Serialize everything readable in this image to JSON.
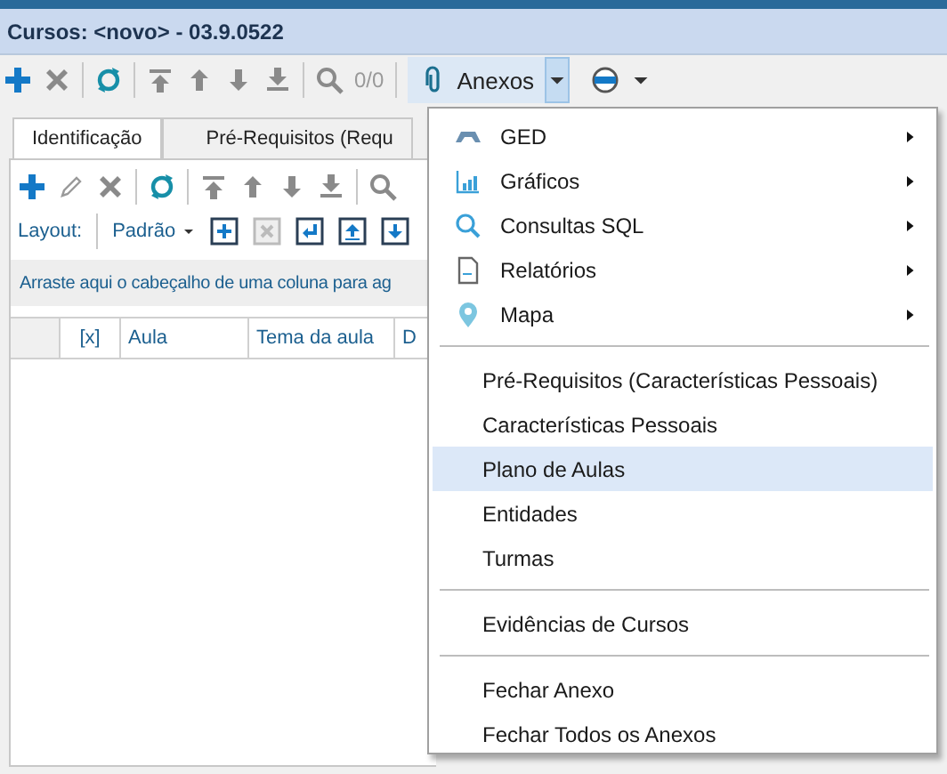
{
  "window": {
    "title": "Cursos: <novo> - 03.9.0522"
  },
  "toolbar": {
    "counter": "0/0",
    "attachments_button": {
      "label": "Anexos",
      "expanded": true
    }
  },
  "tabs": [
    {
      "label": "Identificação",
      "selected": true
    },
    {
      "label": "Pré-Requisitos (Requ",
      "selected": false
    }
  ],
  "layout": {
    "label": "Layout:",
    "value": "Padrão"
  },
  "group_panel": {
    "hint": "Arraste aqui o cabeçalho de uma coluna para ag"
  },
  "table": {
    "columns": [
      "[x]",
      "Aula",
      "Tema da aula",
      "D"
    ]
  },
  "menu": {
    "items": [
      {
        "kind": "submenu",
        "label": "GED"
      },
      {
        "kind": "submenu",
        "label": "Gráficos"
      },
      {
        "kind": "submenu",
        "label": "Consultas SQL"
      },
      {
        "kind": "submenu",
        "label": "Relatórios"
      },
      {
        "kind": "submenu",
        "label": "Mapa"
      },
      {
        "kind": "separator"
      },
      {
        "kind": "item",
        "label": "Pré-Requisitos (Características Pessoais)",
        "selected": false
      },
      {
        "kind": "item",
        "label": "Características Pessoais",
        "selected": false
      },
      {
        "kind": "item",
        "label": "Plano de Aulas",
        "selected": true
      },
      {
        "kind": "item",
        "label": "Entidades",
        "selected": false
      },
      {
        "kind": "item",
        "label": "Turmas",
        "selected": false
      },
      {
        "kind": "separator"
      },
      {
        "kind": "item",
        "label": "Evidências de Cursos",
        "selected": false
      },
      {
        "kind": "separator"
      },
      {
        "kind": "item",
        "label": "Fechar Anexo",
        "selected": false
      },
      {
        "kind": "item",
        "label": "Fechar Todos os Anexos",
        "selected": false
      }
    ]
  }
}
